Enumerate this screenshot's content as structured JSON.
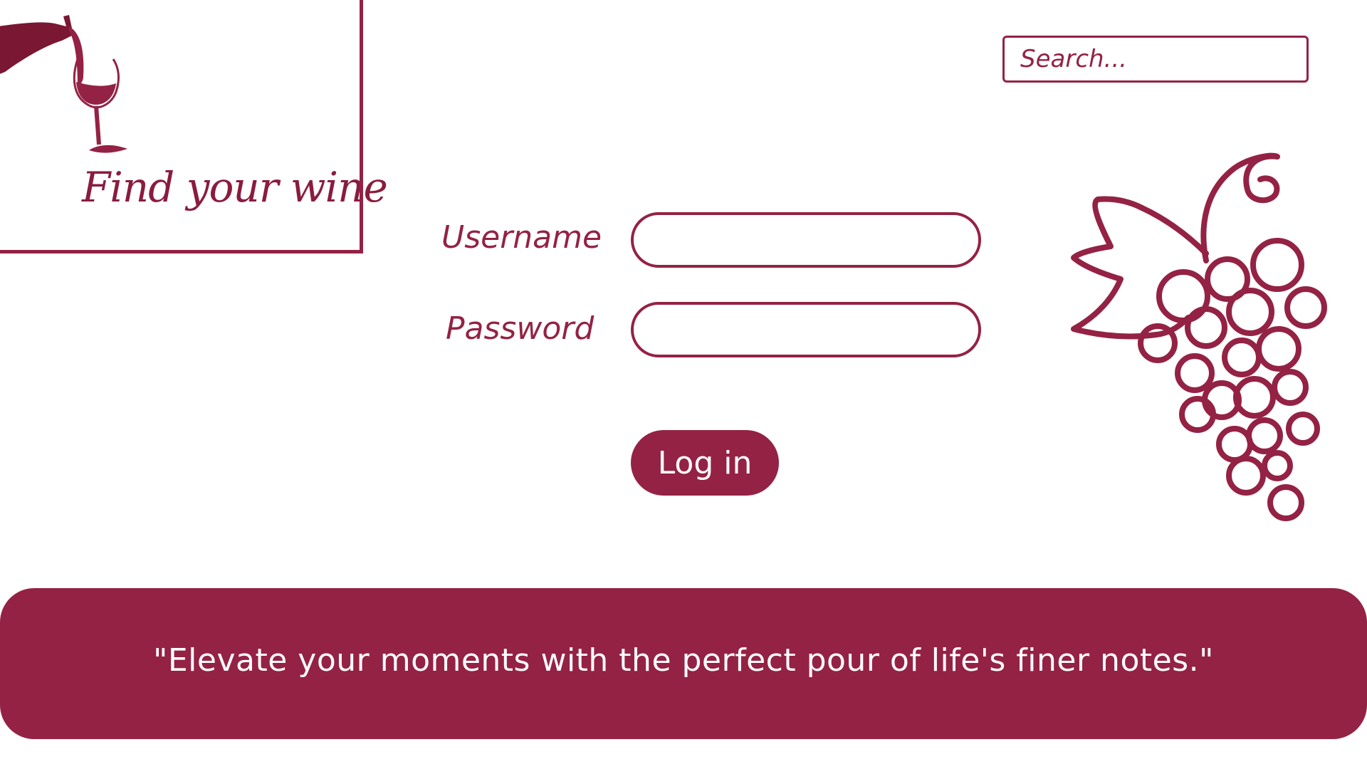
{
  "brand": {
    "title": "Find your wine",
    "logo_icon": "wine-pour-icon"
  },
  "search": {
    "placeholder": "Search..."
  },
  "login_form": {
    "username_label": "Username",
    "username_value": "",
    "password_label": "Password",
    "password_value": "",
    "submit_label": "Log in"
  },
  "decoration": {
    "grapes_icon": "grapes-icon"
  },
  "footer": {
    "quote": "\"Elevate your moments with the perfect pour of life's finer notes.\""
  },
  "colors": {
    "accent": "#942244",
    "background": "#ffffff",
    "on_accent": "#ffffff"
  }
}
